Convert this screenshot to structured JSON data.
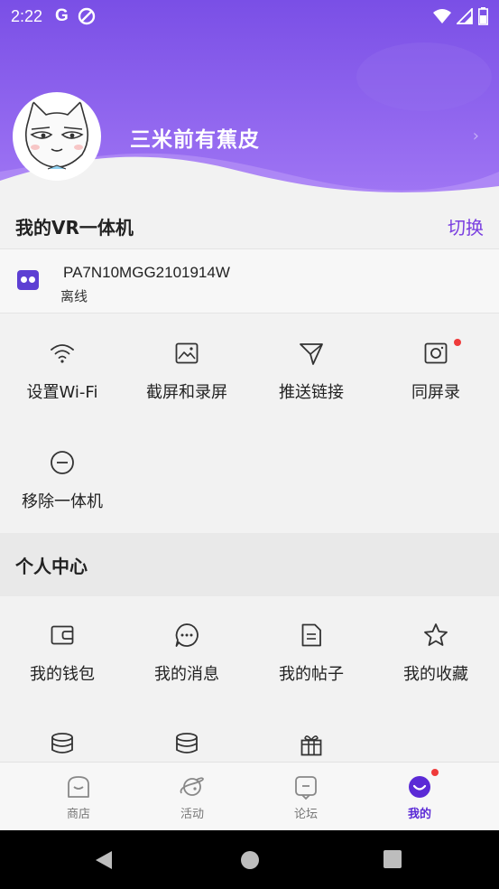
{
  "status_bar": {
    "time": "2:22",
    "g_icon": "G"
  },
  "profile": {
    "username": "三米前有蕉皮"
  },
  "vr_section": {
    "title": "我的VR一体机",
    "switch_label": "切换"
  },
  "device": {
    "serial": "PA7N10MGG2101914W",
    "status": "离线"
  },
  "device_actions": [
    {
      "label": "设置Wi-Fi",
      "icon": "wifi-icon"
    },
    {
      "label": "截屏和录屏",
      "icon": "image-icon"
    },
    {
      "label": "推送链接",
      "icon": "send-icon"
    },
    {
      "label": "同屏录",
      "icon": "camera-icon",
      "badge": true
    },
    {
      "label": "移除一体机",
      "icon": "minus-circle-icon"
    }
  ],
  "personal_section": {
    "title": "个人中心"
  },
  "personal_actions": [
    {
      "label": "我的钱包",
      "icon": "wallet-icon"
    },
    {
      "label": "我的消息",
      "icon": "message-icon"
    },
    {
      "label": "我的帖子",
      "icon": "document-icon"
    },
    {
      "label": "我的收藏",
      "icon": "star-icon"
    }
  ],
  "bottom_nav": [
    {
      "label": "商店",
      "icon": "store-icon"
    },
    {
      "label": "活动",
      "icon": "planet-icon"
    },
    {
      "label": "论坛",
      "icon": "forum-icon"
    },
    {
      "label": "我的",
      "icon": "smile-icon",
      "active": true,
      "badge": true
    }
  ],
  "colors": {
    "accent": "#7a3fe0",
    "header": "#8a5cf0",
    "badge": "#ef3b3b"
  }
}
